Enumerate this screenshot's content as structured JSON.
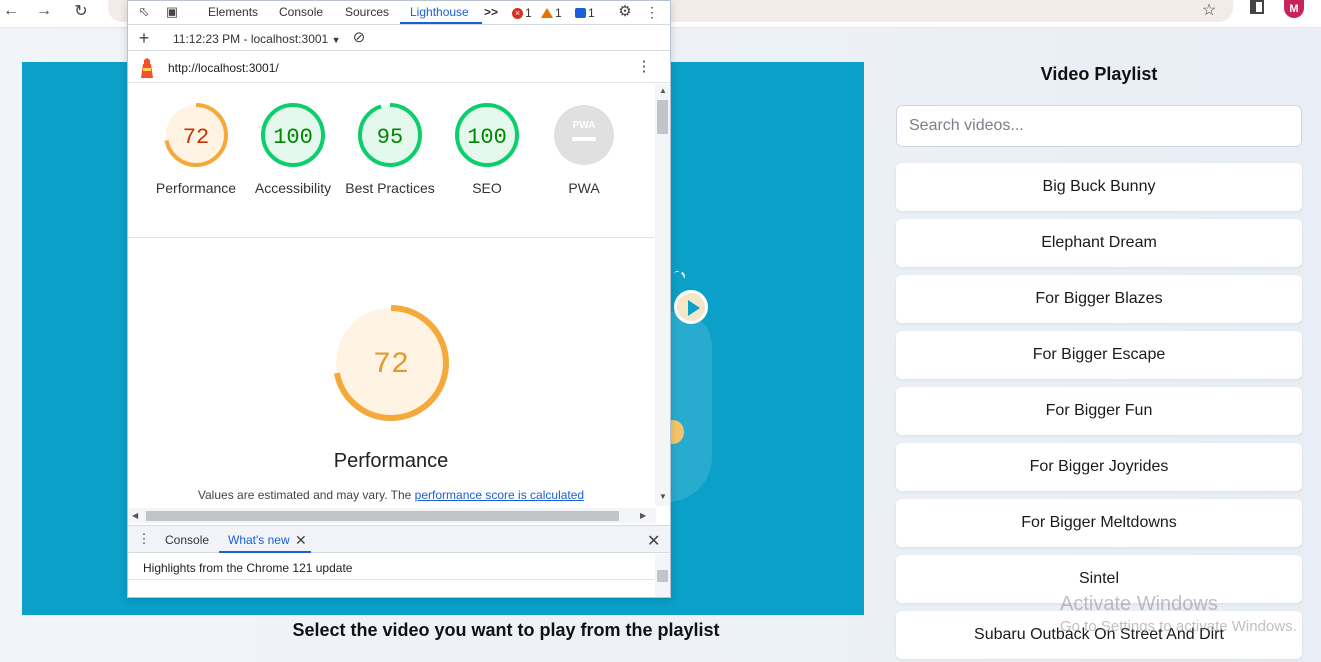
{
  "browser": {
    "back_icon": "arrow-left-icon",
    "forward_icon": "arrow-right-icon",
    "reload_icon": "reload-icon",
    "bookmark_icon": "star-icon",
    "avatar_initial": "M"
  },
  "devtools": {
    "tabs": [
      "Elements",
      "Console",
      "Sources",
      "Lighthouse"
    ],
    "active_tab": "Lighthouse",
    "more_tabs_glyph": ">>",
    "errors": "1",
    "warnings": "1",
    "messages": "1",
    "report_selector": "11:12:23 PM - localhost:3001",
    "report_url": "http://localhost:3001/",
    "gauges": [
      {
        "score": "72",
        "label": "Performance",
        "value": 72,
        "color": "#f4a93a",
        "bg": "#fff3e3",
        "text_color": "#c33300"
      },
      {
        "score": "100",
        "label": "Accessibility",
        "value": 100,
        "color": "#0cce6b",
        "bg": "#e5f8ee",
        "text_color": "#008800"
      },
      {
        "score": "95",
        "label": "Best Practices",
        "value": 95,
        "color": "#0cce6b",
        "bg": "#e5f8ee",
        "text_color": "#008800"
      },
      {
        "score": "100",
        "label": "SEO",
        "value": 100,
        "color": "#0cce6b",
        "bg": "#e5f8ee",
        "text_color": "#008800"
      },
      {
        "score": "PWA",
        "label": "PWA",
        "value": 0,
        "color": "#e0e0e0",
        "bg": "#e0e0e0",
        "text_color": "#ffffff"
      }
    ],
    "big_gauge": {
      "score": "72",
      "value": 72,
      "color": "#f4a93a",
      "bg": "#fff3e3",
      "text_color": "#e29a2c"
    },
    "perf_title": "Performance",
    "perf_note_prefix": "Values are estimated and may vary. The ",
    "perf_note_link": "performance score is calculated",
    "drawer_tabs": [
      "Console",
      "What's new"
    ],
    "drawer_active": "What's new",
    "drawer_text": "Highlights from the Chrome 121 update"
  },
  "page": {
    "caption": "Select the video you want to play from the playlist",
    "playlist_title": "Video Playlist",
    "search_placeholder": "Search videos...",
    "videos": [
      "Big Buck Bunny",
      "Elephant Dream",
      "For Bigger Blazes",
      "For Bigger Escape",
      "For Bigger Fun",
      "For Bigger Joyrides",
      "For Bigger Meltdowns",
      "Sintel",
      "Subaru Outback On Street And Dirt"
    ],
    "video_bg_color": "#0aa0c8"
  },
  "watermark": {
    "line1": "Activate Windows",
    "line2": "Go to Settings to activate Windows."
  }
}
